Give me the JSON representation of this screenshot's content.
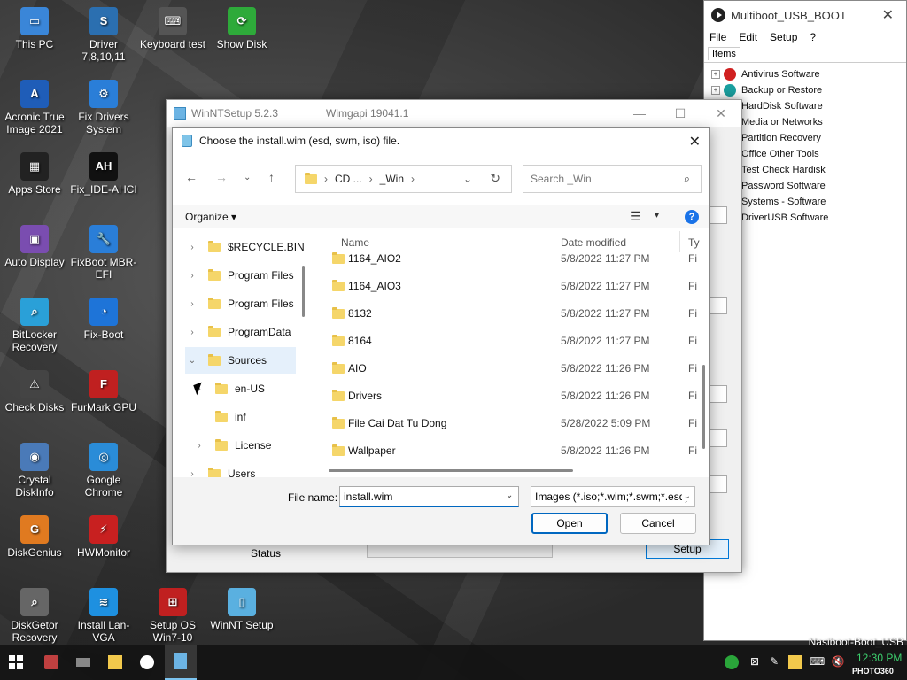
{
  "desktop": {
    "icons": [
      {
        "label": "This PC",
        "color": "#3a86d8",
        "glyph": "▭"
      },
      {
        "label": "Driver 7,8,10,11",
        "color": "#2b6fb0",
        "glyph": "S"
      },
      {
        "label": "Keyboard test",
        "color": "#555",
        "glyph": "⌨"
      },
      {
        "label": "Show Disk",
        "color": "#2eaa3a",
        "glyph": "⟳"
      },
      {
        "label": "Acronic True Image 2021",
        "color": "#1f5db8",
        "glyph": "A"
      },
      {
        "label": "Fix Drivers System",
        "color": "#2a7ed8",
        "glyph": "⚙"
      },
      {
        "label": "Apps Store",
        "color": "#222",
        "glyph": "▦"
      },
      {
        "label": "Fix_IDE-AHCI",
        "color": "#111",
        "glyph": "AH"
      },
      {
        "label": "Auto Display",
        "color": "#7a4db0",
        "glyph": "▣"
      },
      {
        "label": "FixBoot MBR-EFI",
        "color": "#2a7ed8",
        "glyph": "🔧"
      },
      {
        "label": "BitLocker Recovery",
        "color": "#2aa0d8",
        "glyph": "⌕"
      },
      {
        "label": "Fix-Boot",
        "color": "#1e74d8",
        "glyph": "◔"
      },
      {
        "label": "Check Disks",
        "color": "#444",
        "glyph": "⚠"
      },
      {
        "label": "FurMark GPU",
        "color": "#c02020",
        "glyph": "F"
      },
      {
        "label": "Crystal DiskInfo",
        "color": "#4a7ab8",
        "glyph": "◉"
      },
      {
        "label": "Google Chrome",
        "color": "#2a8cd8",
        "glyph": "◎"
      },
      {
        "label": "DiskGenius",
        "color": "#e07a20",
        "glyph": "G"
      },
      {
        "label": "HWMonitor",
        "color": "#c82020",
        "glyph": "⚡"
      },
      {
        "label": "DiskGetor Recovery",
        "color": "#666",
        "glyph": "⌕"
      },
      {
        "label": "Install Lan-VGA",
        "color": "#1e90e0",
        "glyph": "≋"
      },
      {
        "label": "Setup OS Win7-10",
        "color": "#c02020",
        "glyph": "⊞"
      },
      {
        "label": "WinNT Setup",
        "color": "#5ab0e0",
        "glyph": "▯"
      }
    ]
  },
  "multiboot": {
    "title": "Multiboot_USB_BOOT",
    "menu": [
      "File",
      "Edit",
      "Setup",
      "?"
    ],
    "tab": "Items",
    "items": [
      {
        "label": "Antivirus Software",
        "expand": "+"
      },
      {
        "label": "Backup or Restore",
        "expand": "+"
      },
      {
        "label": "HardDisk Software",
        "expand": ""
      },
      {
        "label": "Media or Networks",
        "expand": ""
      },
      {
        "label": "Partition Recovery",
        "expand": ""
      },
      {
        "label": "Office Other Tools",
        "expand": ""
      },
      {
        "label": "Test Check Hardisk",
        "expand": ""
      },
      {
        "label": "Password Software",
        "expand": ""
      },
      {
        "label": "Systems - Software",
        "expand": ""
      },
      {
        "label": "DriverUSB Software",
        "expand": ""
      }
    ],
    "footer": "Nasiboot-Boot_USB"
  },
  "winnt": {
    "title": "WinNTSetup 5.2.3",
    "subtitle": "Wimgapi 19041.1",
    "status_label": "Status",
    "setup_label": "Setup"
  },
  "dialog": {
    "title": "Choose the install.wim (esd, swm, iso) file.",
    "address": [
      "CD ...",
      "_Win"
    ],
    "search_placeholder": "Search _Win",
    "organize": "Organize",
    "nav": [
      {
        "label": "$RECYCLE.BIN",
        "indent": 0,
        "chev": "›"
      },
      {
        "label": "Program Files",
        "indent": 0,
        "chev": "›"
      },
      {
        "label": "Program Files",
        "indent": 0,
        "chev": "›"
      },
      {
        "label": "ProgramData",
        "indent": 0,
        "chev": "›"
      },
      {
        "label": "Sources",
        "indent": 0,
        "chev": "⌄",
        "selected": true
      },
      {
        "label": "en-US",
        "indent": 1,
        "chev": "›"
      },
      {
        "label": "inf",
        "indent": 1,
        "chev": ""
      },
      {
        "label": "License",
        "indent": 1,
        "chev": "›"
      },
      {
        "label": "Users",
        "indent": 0,
        "chev": "›"
      }
    ],
    "columns": {
      "name": "Name",
      "date": "Date modified",
      "type": "Ty"
    },
    "files": [
      {
        "name": "1164_AIO2",
        "date": "5/8/2022 11:27 PM",
        "type": "Fi"
      },
      {
        "name": "1164_AIO3",
        "date": "5/8/2022 11:27 PM",
        "type": "Fi"
      },
      {
        "name": "8132",
        "date": "5/8/2022 11:27 PM",
        "type": "Fi"
      },
      {
        "name": "8164",
        "date": "5/8/2022 11:27 PM",
        "type": "Fi"
      },
      {
        "name": "AIO",
        "date": "5/8/2022 11:26 PM",
        "type": "Fi"
      },
      {
        "name": "Drivers",
        "date": "5/8/2022 11:26 PM",
        "type": "Fi"
      },
      {
        "name": "File Cai Dat Tu Dong",
        "date": "5/28/2022 5:09 PM",
        "type": "Fi"
      },
      {
        "name": "Wallpaper",
        "date": "5/8/2022 11:26 PM",
        "type": "Fi"
      }
    ],
    "filename_label": "File name:",
    "filename_value": "install.wim",
    "filetype": "Images (*.iso;*.wim;*.swm;*.esd)",
    "open": "Open",
    "cancel": "Cancel"
  },
  "taskbar": {
    "clock": "12:30 PM"
  },
  "watermark": "PHOTO360"
}
